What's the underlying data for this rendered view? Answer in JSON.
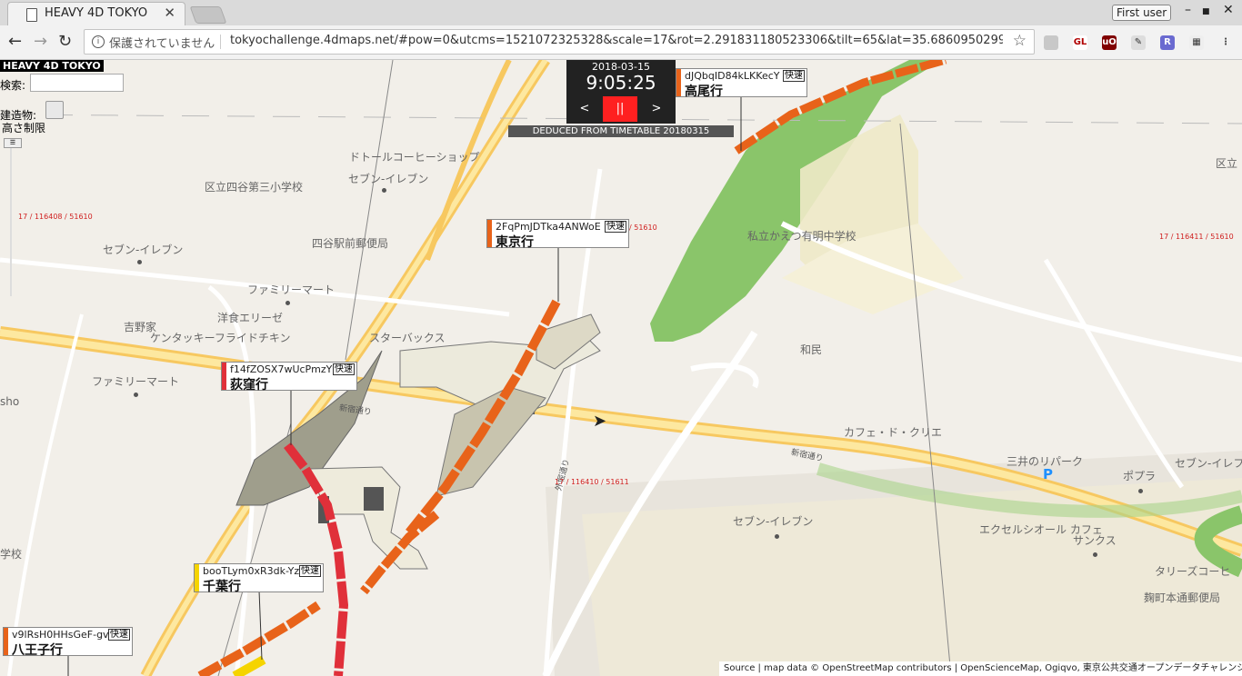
{
  "browser": {
    "tab_title": "HEAVY 4D TOKYO",
    "tab_close": "✕",
    "user_button": "First user",
    "win_minimize": "–",
    "win_maximize": "■",
    "win_close": "✕",
    "nav_back": "←",
    "nav_forward": "→",
    "nav_reload": "↻",
    "info_icon": "i",
    "security_text": "保護されていません",
    "url": "tokyochallenge.4dmaps.net/#pow=0&utcms=1521072325328&scale=17&rot=2.291831180523306&tilt=65&lat=35.68609502993057…",
    "star_icon": "☆",
    "extensions": [
      {
        "name": "circle-extension-icon",
        "text": "",
        "color": "#c8c8c8"
      },
      {
        "name": "gl-extension-icon",
        "text": "GL",
        "color": "#ffffff"
      },
      {
        "name": "ublock-extension-icon",
        "text": "uO",
        "color": "#800000"
      },
      {
        "name": "eyedropper-extension-icon",
        "text": "✎",
        "color": "#dddddd"
      },
      {
        "name": "r-extension-icon",
        "text": "R",
        "color": "#6a6ad0"
      },
      {
        "name": "chart-extension-icon",
        "text": "▦",
        "color": "#eeeeee"
      },
      {
        "name": "menu-icon",
        "text": "⋮",
        "color": "#f2f2f2"
      }
    ]
  },
  "app": {
    "title": "HEAVY 4D TOKYO",
    "search_label": "検索:",
    "search_value": "",
    "building_label": "建造物:",
    "height_limit_label": "高さ制限",
    "slider_thumb": "☰"
  },
  "clock": {
    "date": "2018-03-15",
    "time": "9:05:25",
    "prev": "<",
    "pause": "||",
    "next": ">",
    "deduced": "DEDUCED FROM TIMETABLE 20180315"
  },
  "trains": [
    {
      "id": "dJQbqID84kLKKecY",
      "badge": "快速",
      "dest": "高尾行",
      "color": "#e8631a"
    },
    {
      "id": "2FqPmJDTka4ANWoE",
      "badge": "快速",
      "dest": "東京行",
      "color": "#e8631a"
    },
    {
      "id": "f14fZOSX7wUcPmzY",
      "badge": "快速",
      "dest": "荻窪行",
      "color": "#e0303a"
    },
    {
      "id": "booTLym0xR3dk-Yz",
      "badge": "快速",
      "dest": "千葉行",
      "color": "#f5d400"
    },
    {
      "id": "v9lRsH0HHsGeF-gv",
      "badge": "快速",
      "dest": "八王子行",
      "color": "#e8631a"
    }
  ],
  "map_labels": {
    "doutor": "ドトールコーヒーショップ",
    "seven1": "セブン-イレブン",
    "school1": "区立四谷第三小学校",
    "seven2": "セブン-イレブン",
    "post": "四谷駅前郵便局",
    "famima1": "ファミリーマート",
    "yoshinoya": "吉野家",
    "yoshoku": "洋食エリーゼ",
    "kfc": "ケンタッキーフライドチキン",
    "starbucks": "スターバックス",
    "famima2": "ファミリーマート",
    "sho": "sho",
    "school2": "学校",
    "school3": "私立かえつ有明中学校",
    "kuritsu": "区立",
    "wamin": "和民",
    "cafe_crie": "カフェ・ド・クリエ",
    "mitsui": "三井のリパーク",
    "popura": "ポプラ",
    "seven3": "セブン-イレフ",
    "seven4": "セブン-イレブン",
    "excelsior": "エクセルシオール カフェ",
    "sankusu": "サンクス",
    "tullys": "タリーズコーヒ",
    "kojimachi": "麹町本通郵便局",
    "shinjuku_dori1": "新宿通り",
    "shinjuku_dori2": "新宿通り",
    "sotobori": "外堀通り",
    "coord1": "17 / 116410 / 51611",
    "coord2": "17 / 116408 / 51610",
    "coord3": "17 / 116411 / 51610",
    "coord4": "/ 51610"
  },
  "attribution": "Source | map data © OpenStreetMap contributors | OpenScienceMap, Ogiqvo, 東京公共交通オープンデータチャレンジ"
}
